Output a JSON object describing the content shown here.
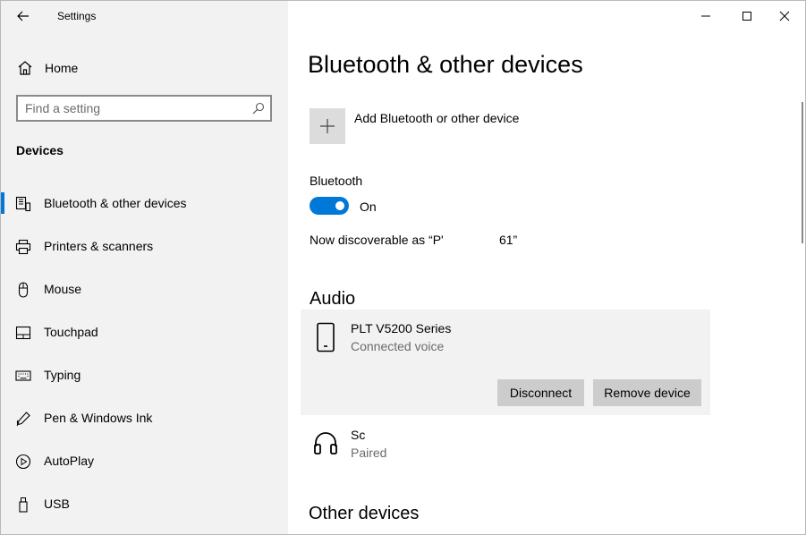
{
  "window": {
    "title": "Settings"
  },
  "sidebar": {
    "home_label": "Home",
    "search_placeholder": "Find a setting",
    "section_title": "Devices",
    "items": [
      {
        "label": "Bluetooth & other devices",
        "icon": "bluetooth-devices-icon",
        "active": true
      },
      {
        "label": "Printers & scanners",
        "icon": "printer-icon"
      },
      {
        "label": "Mouse",
        "icon": "mouse-icon"
      },
      {
        "label": "Touchpad",
        "icon": "touchpad-icon"
      },
      {
        "label": "Typing",
        "icon": "keyboard-icon"
      },
      {
        "label": "Pen & Windows Ink",
        "icon": "pen-icon"
      },
      {
        "label": "AutoPlay",
        "icon": "autoplay-icon"
      },
      {
        "label": "USB",
        "icon": "usb-icon"
      }
    ]
  },
  "main": {
    "title": "Bluetooth & other devices",
    "add_device_label": "Add Bluetooth or other device",
    "bluetooth_label": "Bluetooth",
    "bluetooth_state": "On",
    "bluetooth_on": true,
    "discoverable_text": "Now discoverable as “P'                61”",
    "audio_heading": "Audio",
    "audio_devices": [
      {
        "name": "PLT V5200 Series",
        "status": "Connected voice",
        "icon": "phone-icon",
        "selected": true,
        "buttons": {
          "disconnect": "Disconnect",
          "remove": "Remove device"
        }
      },
      {
        "name": "Sc",
        "status": "Paired",
        "icon": "headphones-icon"
      }
    ],
    "other_heading": "Other devices"
  },
  "colors": {
    "accent": "#0078d7",
    "sidebar_bg": "#f2f2f2",
    "button_bg": "#cccccc"
  }
}
